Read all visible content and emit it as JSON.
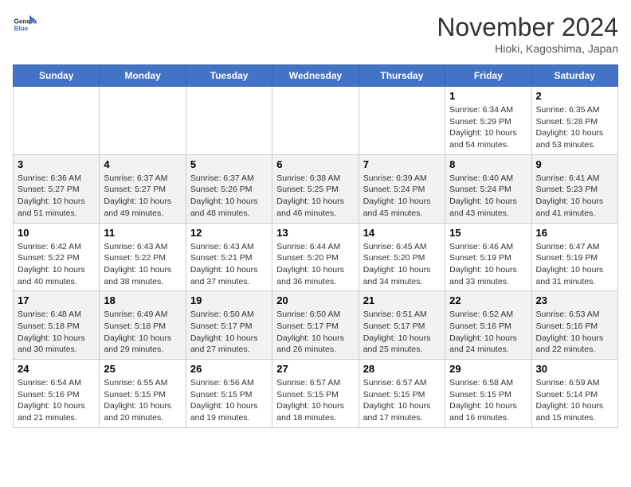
{
  "header": {
    "logo_line1": "General",
    "logo_line2": "Blue",
    "month_title": "November 2024",
    "location": "Hioki, Kagoshima, Japan"
  },
  "weekdays": [
    "Sunday",
    "Monday",
    "Tuesday",
    "Wednesday",
    "Thursday",
    "Friday",
    "Saturday"
  ],
  "weeks": [
    [
      {
        "day": "",
        "sunrise": "",
        "sunset": "",
        "daylight": ""
      },
      {
        "day": "",
        "sunrise": "",
        "sunset": "",
        "daylight": ""
      },
      {
        "day": "",
        "sunrise": "",
        "sunset": "",
        "daylight": ""
      },
      {
        "day": "",
        "sunrise": "",
        "sunset": "",
        "daylight": ""
      },
      {
        "day": "",
        "sunrise": "",
        "sunset": "",
        "daylight": ""
      },
      {
        "day": "1",
        "sunrise": "Sunrise: 6:34 AM",
        "sunset": "Sunset: 5:29 PM",
        "daylight": "Daylight: 10 hours and 54 minutes."
      },
      {
        "day": "2",
        "sunrise": "Sunrise: 6:35 AM",
        "sunset": "Sunset: 5:28 PM",
        "daylight": "Daylight: 10 hours and 53 minutes."
      }
    ],
    [
      {
        "day": "3",
        "sunrise": "Sunrise: 6:36 AM",
        "sunset": "Sunset: 5:27 PM",
        "daylight": "Daylight: 10 hours and 51 minutes."
      },
      {
        "day": "4",
        "sunrise": "Sunrise: 6:37 AM",
        "sunset": "Sunset: 5:27 PM",
        "daylight": "Daylight: 10 hours and 49 minutes."
      },
      {
        "day": "5",
        "sunrise": "Sunrise: 6:37 AM",
        "sunset": "Sunset: 5:26 PM",
        "daylight": "Daylight: 10 hours and 48 minutes."
      },
      {
        "day": "6",
        "sunrise": "Sunrise: 6:38 AM",
        "sunset": "Sunset: 5:25 PM",
        "daylight": "Daylight: 10 hours and 46 minutes."
      },
      {
        "day": "7",
        "sunrise": "Sunrise: 6:39 AM",
        "sunset": "Sunset: 5:24 PM",
        "daylight": "Daylight: 10 hours and 45 minutes."
      },
      {
        "day": "8",
        "sunrise": "Sunrise: 6:40 AM",
        "sunset": "Sunset: 5:24 PM",
        "daylight": "Daylight: 10 hours and 43 minutes."
      },
      {
        "day": "9",
        "sunrise": "Sunrise: 6:41 AM",
        "sunset": "Sunset: 5:23 PM",
        "daylight": "Daylight: 10 hours and 41 minutes."
      }
    ],
    [
      {
        "day": "10",
        "sunrise": "Sunrise: 6:42 AM",
        "sunset": "Sunset: 5:22 PM",
        "daylight": "Daylight: 10 hours and 40 minutes."
      },
      {
        "day": "11",
        "sunrise": "Sunrise: 6:43 AM",
        "sunset": "Sunset: 5:22 PM",
        "daylight": "Daylight: 10 hours and 38 minutes."
      },
      {
        "day": "12",
        "sunrise": "Sunrise: 6:43 AM",
        "sunset": "Sunset: 5:21 PM",
        "daylight": "Daylight: 10 hours and 37 minutes."
      },
      {
        "day": "13",
        "sunrise": "Sunrise: 6:44 AM",
        "sunset": "Sunset: 5:20 PM",
        "daylight": "Daylight: 10 hours and 36 minutes."
      },
      {
        "day": "14",
        "sunrise": "Sunrise: 6:45 AM",
        "sunset": "Sunset: 5:20 PM",
        "daylight": "Daylight: 10 hours and 34 minutes."
      },
      {
        "day": "15",
        "sunrise": "Sunrise: 6:46 AM",
        "sunset": "Sunset: 5:19 PM",
        "daylight": "Daylight: 10 hours and 33 minutes."
      },
      {
        "day": "16",
        "sunrise": "Sunrise: 6:47 AM",
        "sunset": "Sunset: 5:19 PM",
        "daylight": "Daylight: 10 hours and 31 minutes."
      }
    ],
    [
      {
        "day": "17",
        "sunrise": "Sunrise: 6:48 AM",
        "sunset": "Sunset: 5:18 PM",
        "daylight": "Daylight: 10 hours and 30 minutes."
      },
      {
        "day": "18",
        "sunrise": "Sunrise: 6:49 AM",
        "sunset": "Sunset: 5:18 PM",
        "daylight": "Daylight: 10 hours and 29 minutes."
      },
      {
        "day": "19",
        "sunrise": "Sunrise: 6:50 AM",
        "sunset": "Sunset: 5:17 PM",
        "daylight": "Daylight: 10 hours and 27 minutes."
      },
      {
        "day": "20",
        "sunrise": "Sunrise: 6:50 AM",
        "sunset": "Sunset: 5:17 PM",
        "daylight": "Daylight: 10 hours and 26 minutes."
      },
      {
        "day": "21",
        "sunrise": "Sunrise: 6:51 AM",
        "sunset": "Sunset: 5:17 PM",
        "daylight": "Daylight: 10 hours and 25 minutes."
      },
      {
        "day": "22",
        "sunrise": "Sunrise: 6:52 AM",
        "sunset": "Sunset: 5:16 PM",
        "daylight": "Daylight: 10 hours and 24 minutes."
      },
      {
        "day": "23",
        "sunrise": "Sunrise: 6:53 AM",
        "sunset": "Sunset: 5:16 PM",
        "daylight": "Daylight: 10 hours and 22 minutes."
      }
    ],
    [
      {
        "day": "24",
        "sunrise": "Sunrise: 6:54 AM",
        "sunset": "Sunset: 5:16 PM",
        "daylight": "Daylight: 10 hours and 21 minutes."
      },
      {
        "day": "25",
        "sunrise": "Sunrise: 6:55 AM",
        "sunset": "Sunset: 5:15 PM",
        "daylight": "Daylight: 10 hours and 20 minutes."
      },
      {
        "day": "26",
        "sunrise": "Sunrise: 6:56 AM",
        "sunset": "Sunset: 5:15 PM",
        "daylight": "Daylight: 10 hours and 19 minutes."
      },
      {
        "day": "27",
        "sunrise": "Sunrise: 6:57 AM",
        "sunset": "Sunset: 5:15 PM",
        "daylight": "Daylight: 10 hours and 18 minutes."
      },
      {
        "day": "28",
        "sunrise": "Sunrise: 6:57 AM",
        "sunset": "Sunset: 5:15 PM",
        "daylight": "Daylight: 10 hours and 17 minutes."
      },
      {
        "day": "29",
        "sunrise": "Sunrise: 6:58 AM",
        "sunset": "Sunset: 5:15 PM",
        "daylight": "Daylight: 10 hours and 16 minutes."
      },
      {
        "day": "30",
        "sunrise": "Sunrise: 6:59 AM",
        "sunset": "Sunset: 5:14 PM",
        "daylight": "Daylight: 10 hours and 15 minutes."
      }
    ]
  ]
}
